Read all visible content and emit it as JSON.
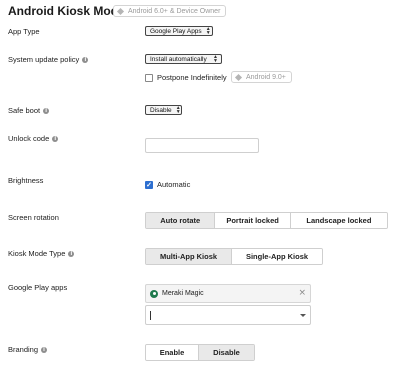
{
  "header": {
    "title": "Android Kiosk Mode",
    "badge": "Android 6.0+ & Device Owner"
  },
  "fields": {
    "app_type": {
      "label": "App Type",
      "value": "Google Play Apps"
    },
    "system_update": {
      "label": "System update policy",
      "value": "Install automatically",
      "postpone_label": "Postpone Indefinitely",
      "postpone_checked": false,
      "postpone_badge": "Android 9.0+"
    },
    "safe_boot": {
      "label": "Safe boot",
      "value": "Disable"
    },
    "unlock_code": {
      "label": "Unlock code",
      "value": ""
    },
    "brightness": {
      "label": "Brightness",
      "checkbox_label": "Automatic",
      "checked": true
    },
    "screen_rotation": {
      "label": "Screen rotation",
      "options": [
        "Auto rotate",
        "Portrait locked",
        "Landscape locked"
      ],
      "selected": "Auto rotate"
    },
    "kiosk_mode_type": {
      "label": "Kiosk Mode Type",
      "options": [
        "Multi-App Kiosk",
        "Single-App Kiosk"
      ],
      "selected": "Multi-App Kiosk"
    },
    "google_play_apps": {
      "label": "Google Play apps",
      "selected_apps": [
        "Meraki Magic"
      ],
      "search_value": ""
    },
    "branding": {
      "label": "Branding",
      "options": [
        "Enable",
        "Disable"
      ],
      "selected": "Disable"
    }
  },
  "icons": {
    "info": "info-icon",
    "badge": "diamond-icon",
    "app": "meraki-app-icon",
    "remove": "close-icon",
    "dropdown": "chevron-down-icon"
  },
  "colors": {
    "checkbox_checked": "#2d6fd0",
    "segment_active": "#e9e9e9",
    "app_icon": "#1f7a4d"
  }
}
